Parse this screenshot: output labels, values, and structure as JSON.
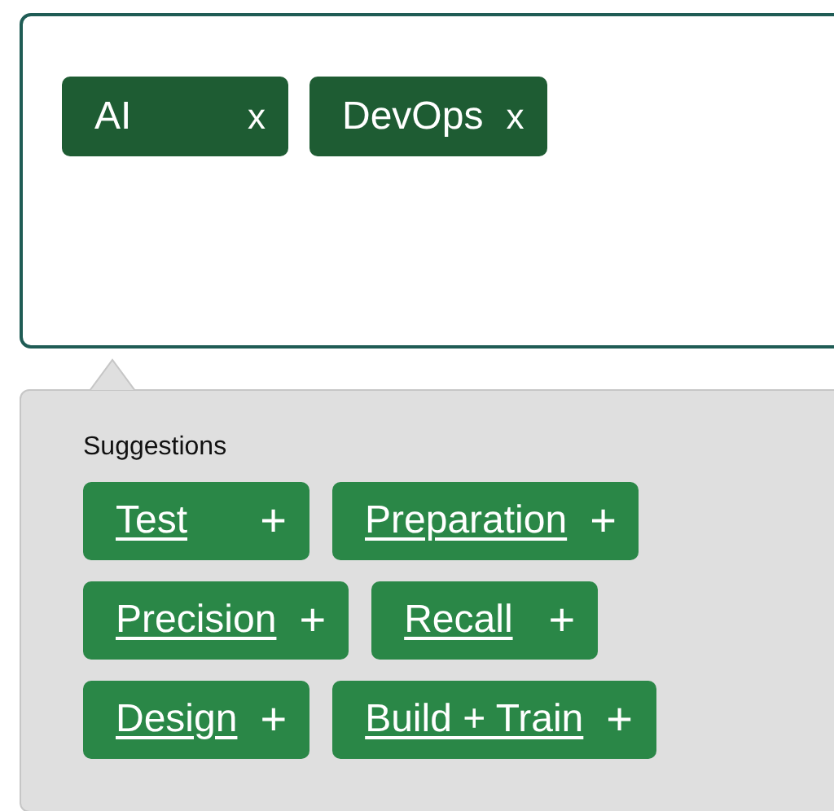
{
  "tags": [
    {
      "label": "AI",
      "remove": "x"
    },
    {
      "label": "DevOps",
      "remove": "x"
    }
  ],
  "suggestions": {
    "title": "Suggestions",
    "items": [
      {
        "label": "Test",
        "add": "+"
      },
      {
        "label": "Preparation",
        "add": "+"
      },
      {
        "label": "Precision",
        "add": "+"
      },
      {
        "label": "Recall",
        "add": "+"
      },
      {
        "label": "Design",
        "add": "+"
      },
      {
        "label": "Build + Train",
        "add": "+"
      }
    ]
  }
}
